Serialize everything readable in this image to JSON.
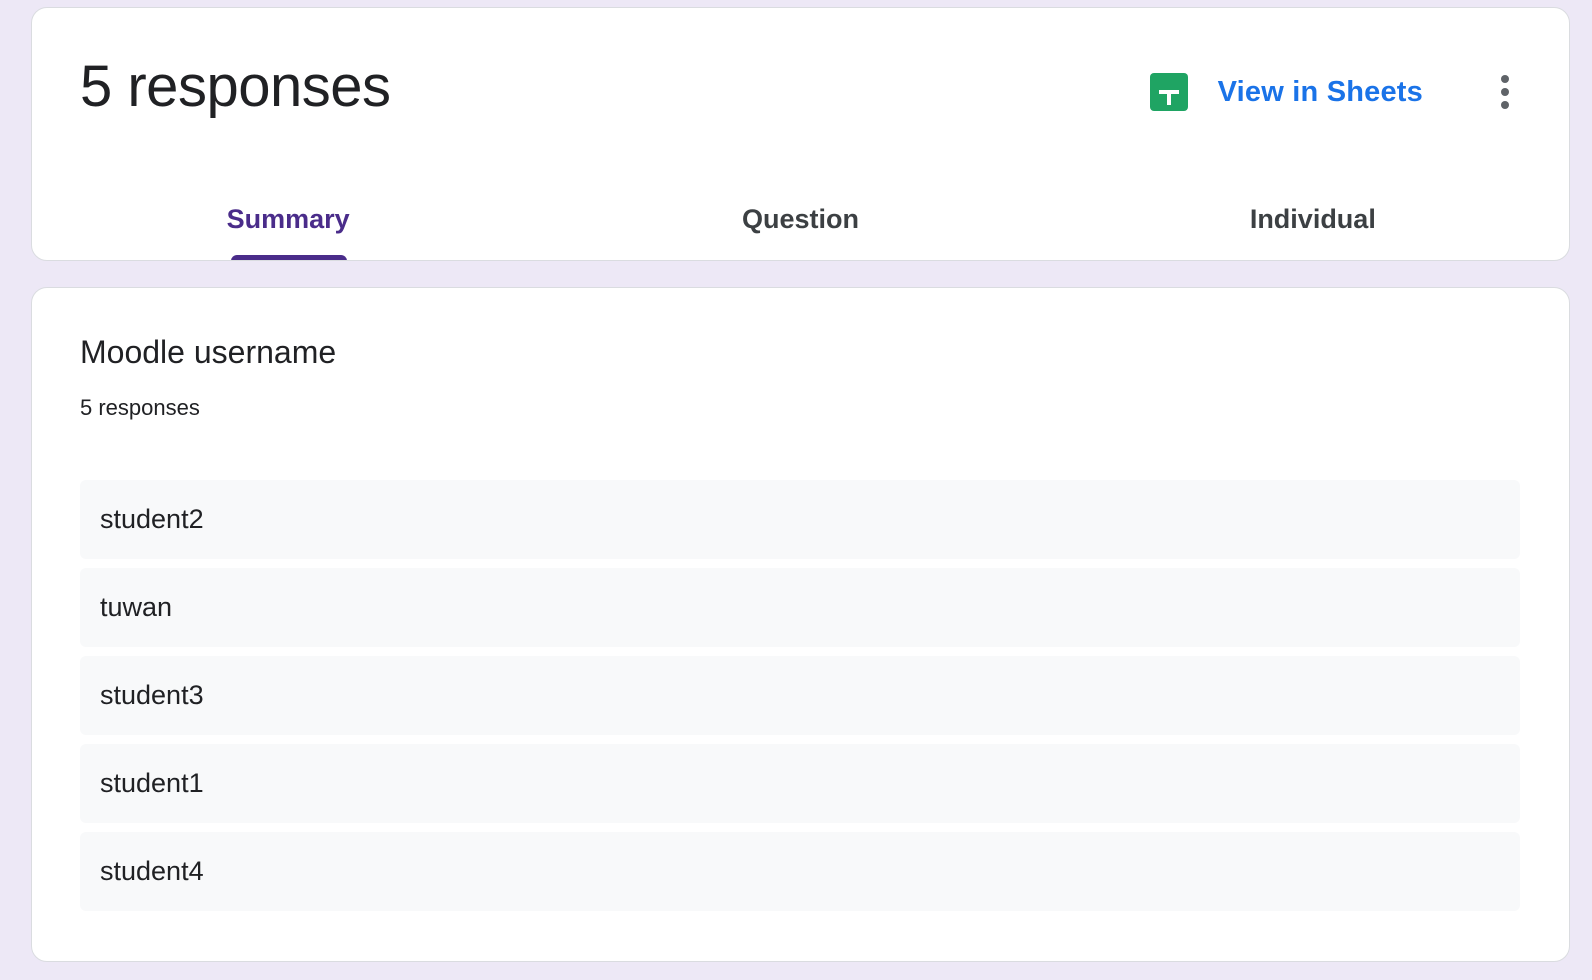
{
  "header": {
    "title": "5 responses",
    "sheets_label": "View in Sheets",
    "sheets_icon": "google-sheets-icon",
    "more_icon": "more-vert-icon"
  },
  "tabs": [
    {
      "label": "Summary",
      "active": true
    },
    {
      "label": "Question",
      "active": false
    },
    {
      "label": "Individual",
      "active": false
    }
  ],
  "question": {
    "title": "Moodle username",
    "response_count": "5 responses",
    "responses": [
      "student2",
      "tuwan",
      "student3",
      "student1",
      "student4"
    ]
  },
  "colors": {
    "background": "#ede8f6",
    "accent": "#4a2c8a",
    "link": "#1a73e8",
    "sheets_green": "#1fa463",
    "row_background": "#f8f9fa"
  }
}
